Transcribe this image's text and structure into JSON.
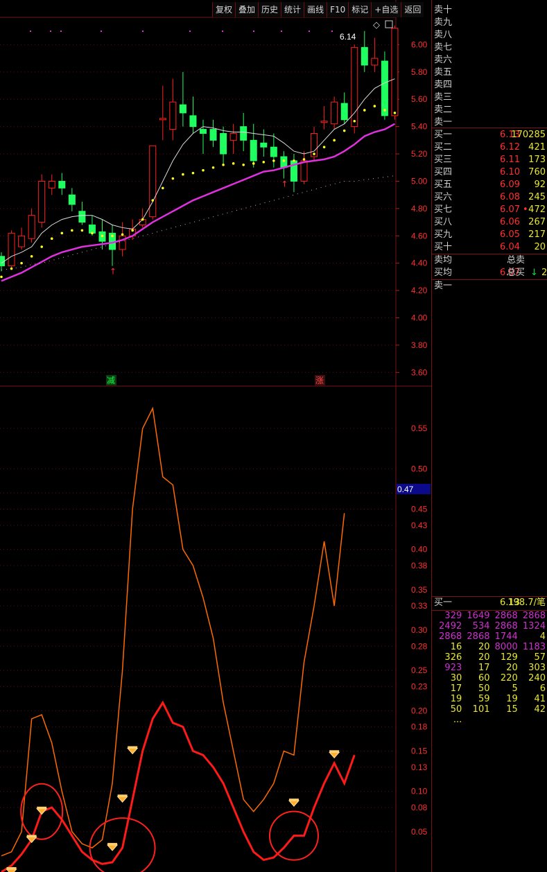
{
  "toolbar": [
    "复权",
    "叠加",
    "历史",
    "统计",
    "画线",
    "F10",
    "标记",
    "+自选",
    "返回"
  ],
  "price_axis": {
    "labels": [
      "6.00",
      "5.80",
      "5.60",
      "5.40",
      "5.20",
      "5.00",
      "4.80",
      "4.60",
      "4.40",
      "4.20",
      "4.00",
      "3.80",
      "3.60"
    ]
  },
  "high_label": "6.14",
  "markers": {
    "minus": "减",
    "plus": "涨"
  },
  "indicator_axis": {
    "labels": [
      "0.55",
      "0.50",
      "0.47",
      "0.45",
      "0.43",
      "0.40",
      "0.38",
      "0.35",
      "0.33",
      "0.30",
      "0.28",
      "0.25",
      "0.23",
      "0.20",
      "0.18",
      "0.15",
      "0.13",
      "0.10",
      "0.08",
      "0.05"
    ],
    "current": "0.47"
  },
  "order_book": {
    "sells": [
      {
        "label": "卖十"
      },
      {
        "label": "卖九"
      },
      {
        "label": "卖八"
      },
      {
        "label": "卖七"
      },
      {
        "label": "卖六"
      },
      {
        "label": "卖五"
      },
      {
        "label": "卖四"
      },
      {
        "label": "卖三"
      },
      {
        "label": "卖二"
      },
      {
        "label": "卖一"
      }
    ],
    "buys": [
      {
        "label": "买一",
        "price": "6.13",
        "vol": "170285"
      },
      {
        "label": "买二",
        "price": "6.12",
        "vol": "421"
      },
      {
        "label": "买三",
        "price": "6.11",
        "vol": "173"
      },
      {
        "label": "买四",
        "price": "6.10",
        "vol": "760"
      },
      {
        "label": "买五",
        "price": "6.09",
        "vol": "92"
      },
      {
        "label": "买六",
        "price": "6.08",
        "vol": "245"
      },
      {
        "label": "买七",
        "price": "6.07",
        "vol": "472",
        "dot": "•"
      },
      {
        "label": "买八",
        "price": "6.06",
        "vol": "267"
      },
      {
        "label": "买九",
        "price": "6.05",
        "vol": "217"
      },
      {
        "label": "买十",
        "price": "6.04",
        "vol": "20"
      }
    ],
    "avg_sell_label": "卖均",
    "total_sell_label": "总卖",
    "avg_buy_label": "买均",
    "avg_buy_price": "6.07",
    "total_buy_label": "总买",
    "total_buy_arrow": "↓",
    "total_buy_value": "2",
    "sell1_label": "卖一"
  },
  "ticks": {
    "header": {
      "label": "买一",
      "price": "6.13",
      "per": "198.7/笔"
    },
    "rows": [
      [
        {
          "v": "329",
          "c": "#d030d0"
        },
        {
          "v": "1649",
          "c": "#d030d0"
        },
        {
          "v": "2868",
          "c": "#d030d0"
        },
        {
          "v": "2868",
          "c": "#d030d0"
        }
      ],
      [
        {
          "v": "2492",
          "c": "#d030d0"
        },
        {
          "v": "534",
          "c": "#d030d0"
        },
        {
          "v": "2868",
          "c": "#d030d0"
        },
        {
          "v": "1324",
          "c": "#d030d0"
        }
      ],
      [
        {
          "v": "2868",
          "c": "#d030d0"
        },
        {
          "v": "2868",
          "c": "#d030d0"
        },
        {
          "v": "1744",
          "c": "#d030d0"
        },
        {
          "v": "4",
          "c": "#e8e832"
        }
      ],
      [
        {
          "v": "16",
          "c": "#e8e832"
        },
        {
          "v": "20",
          "c": "#e8e832"
        },
        {
          "v": "8000",
          "c": "#d030d0"
        },
        {
          "v": "1183",
          "c": "#d030d0"
        }
      ],
      [
        {
          "v": "326",
          "c": "#e8e832"
        },
        {
          "v": "20",
          "c": "#e8e832"
        },
        {
          "v": "129",
          "c": "#e8e832"
        },
        {
          "v": "57",
          "c": "#e8e832"
        }
      ],
      [
        {
          "v": "923",
          "c": "#d030d0"
        },
        {
          "v": "17",
          "c": "#e8e832"
        },
        {
          "v": "20",
          "c": "#e8e832"
        },
        {
          "v": "303",
          "c": "#e8e832"
        }
      ],
      [
        {
          "v": "30",
          "c": "#e8e832"
        },
        {
          "v": "60",
          "c": "#e8e832"
        },
        {
          "v": "220",
          "c": "#e8e832"
        },
        {
          "v": "240",
          "c": "#e8e832"
        }
      ],
      [
        {
          "v": "17",
          "c": "#e8e832"
        },
        {
          "v": "50",
          "c": "#e8e832"
        },
        {
          "v": "5",
          "c": "#e8e832"
        },
        {
          "v": "6",
          "c": "#e8e832"
        }
      ],
      [
        {
          "v": "19",
          "c": "#e8e832"
        },
        {
          "v": "59",
          "c": "#e8e832"
        },
        {
          "v": "19",
          "c": "#e8e832"
        },
        {
          "v": "41",
          "c": "#e8e832"
        }
      ],
      [
        {
          "v": "50",
          "c": "#e8e832"
        },
        {
          "v": "101",
          "c": "#e8e832"
        },
        {
          "v": "15",
          "c": "#e8e832"
        },
        {
          "v": "42",
          "c": "#e8e832"
        }
      ],
      [
        {
          "v": "...",
          "c": "#e8e832"
        },
        {
          "v": "",
          "c": "#e8e832"
        },
        {
          "v": "",
          "c": "#e8e832"
        },
        {
          "v": "",
          "c": "#e8e832"
        }
      ]
    ]
  },
  "chart_data": [
    {
      "type": "candlestick",
      "y_axis_range": [
        3.5,
        6.2
      ],
      "candles": [
        [
          4.45,
          4.38,
          4.48,
          4.34
        ],
        [
          4.38,
          4.62,
          4.64,
          4.36
        ],
        [
          4.52,
          4.6,
          4.66,
          4.5
        ],
        [
          4.58,
          4.75,
          4.8,
          4.55
        ],
        [
          4.7,
          5.0,
          5.05,
          4.66
        ],
        [
          4.95,
          5.0,
          5.05,
          4.9
        ],
        [
          5.0,
          4.95,
          5.06,
          4.9
        ],
        [
          4.9,
          4.83,
          4.95,
          4.78
        ],
        [
          4.78,
          4.7,
          4.85,
          4.68
        ],
        [
          4.68,
          4.62,
          4.75,
          4.6
        ],
        [
          4.63,
          4.56,
          4.72,
          4.5
        ],
        [
          4.62,
          4.5,
          4.68,
          4.38
        ],
        [
          4.5,
          4.6,
          4.7,
          4.45
        ],
        [
          4.6,
          4.65,
          4.72,
          4.57
        ],
        [
          4.68,
          4.72,
          4.8,
          4.66
        ],
        [
          4.74,
          5.26,
          5.26,
          4.72
        ],
        [
          5.45,
          5.46,
          5.7,
          5.3
        ],
        [
          5.38,
          5.58,
          5.75,
          5.3
        ],
        [
          5.56,
          5.5,
          5.8,
          5.4
        ],
        [
          5.48,
          5.4,
          5.62,
          5.35
        ],
        [
          5.38,
          5.35,
          5.45,
          5.2
        ],
        [
          5.38,
          5.3,
          5.45,
          5.25
        ],
        [
          5.35,
          5.2,
          5.4,
          5.12
        ],
        [
          5.3,
          5.35,
          5.42,
          5.2
        ],
        [
          5.4,
          5.3,
          5.5,
          5.22
        ],
        [
          5.3,
          5.15,
          5.42,
          5.1
        ],
        [
          5.28,
          5.25,
          5.38,
          5.18
        ],
        [
          5.25,
          5.18,
          5.35,
          5.1
        ],
        [
          5.18,
          5.1,
          5.22,
          5.02
        ],
        [
          5.15,
          5.0,
          5.2,
          4.92
        ],
        [
          5.0,
          5.15,
          5.22,
          4.98
        ],
        [
          5.18,
          5.35,
          5.4,
          5.15
        ],
        [
          5.43,
          5.44,
          5.55,
          5.38
        ],
        [
          5.42,
          5.58,
          5.62,
          5.38
        ],
        [
          5.57,
          5.45,
          5.65,
          5.42
        ],
        [
          5.4,
          5.98,
          6.0,
          5.35
        ],
        [
          5.98,
          5.85,
          6.1,
          5.8
        ],
        [
          5.85,
          5.9,
          6.05,
          5.8
        ],
        [
          5.88,
          5.48,
          5.95,
          5.45
        ],
        [
          5.48,
          6.12,
          6.14,
          5.45
        ]
      ],
      "ma_white": [
        4.4,
        4.45,
        4.48,
        4.52,
        4.62,
        4.68,
        4.72,
        4.74,
        4.75,
        4.75,
        4.72,
        4.68,
        4.66,
        4.65,
        4.72,
        4.85,
        5.0,
        5.15,
        5.27,
        5.35,
        5.4,
        5.39,
        5.37,
        5.36,
        5.36,
        5.35,
        5.34,
        5.33,
        5.28,
        5.22,
        5.2,
        5.22,
        5.3,
        5.38,
        5.42,
        5.5,
        5.6,
        5.68,
        5.72,
        5.75
      ],
      "ma_magenta": [
        4.27,
        4.3,
        4.33,
        4.37,
        4.41,
        4.45,
        4.48,
        4.5,
        4.52,
        4.53,
        4.54,
        4.55,
        4.57,
        4.6,
        4.65,
        4.7,
        4.74,
        4.78,
        4.82,
        4.86,
        4.89,
        4.92,
        4.95,
        4.98,
        5.01,
        5.04,
        5.07,
        5.08,
        5.1,
        5.12,
        5.14,
        5.15,
        5.16,
        5.18,
        5.22,
        5.27,
        5.33,
        5.36,
        5.38,
        5.42
      ],
      "ma_yellow": [
        4.3,
        4.36,
        4.4,
        4.45,
        4.52,
        4.58,
        4.62,
        4.64,
        4.64,
        4.62,
        4.6,
        4.6,
        4.61,
        4.64,
        4.72,
        4.86,
        4.95,
        5.02,
        5.05,
        5.06,
        5.08,
        5.1,
        5.12,
        5.13,
        5.12,
        5.13,
        5.14,
        5.15,
        5.15,
        5.15,
        5.16,
        5.2,
        5.25,
        5.3,
        5.37,
        5.44,
        5.52,
        5.55,
        5.52,
        5.5
      ],
      "ma_dotted": [
        4.35,
        4.36,
        4.37,
        4.39,
        4.4,
        4.42,
        4.44,
        4.46,
        4.48,
        4.5,
        4.52,
        4.54,
        4.56,
        4.58,
        4.6,
        4.62,
        4.64,
        4.66,
        4.68,
        4.7,
        4.72,
        4.74,
        4.76,
        4.78,
        4.8,
        4.82,
        4.84,
        4.86,
        4.88,
        4.9,
        4.92,
        4.94,
        4.96,
        4.98,
        5.0,
        5.0,
        5.01,
        5.02,
        5.03,
        5.04
      ]
    },
    {
      "type": "line",
      "y_axis_range": [
        0.0,
        0.6
      ],
      "series": [
        {
          "color": "#ff6a00",
          "values": [
            0.02,
            0.025,
            0.05,
            0.19,
            0.195,
            0.16,
            0.1,
            0.05,
            0.035,
            0.03,
            0.04,
            0.11,
            0.25,
            0.45,
            0.55,
            0.575,
            0.49,
            0.48,
            0.4,
            0.38,
            0.34,
            0.29,
            0.21,
            0.15,
            0.09,
            0.075,
            0.09,
            0.11,
            0.15,
            0.145,
            0.26,
            0.33,
            0.41,
            0.33,
            0.445
          ]
        },
        {
          "color": "#ff1a1a",
          "values": [
            0.0,
            0.008,
            0.022,
            0.04,
            0.075,
            0.08,
            0.065,
            0.045,
            0.025,
            0.015,
            0.01,
            0.012,
            0.03,
            0.09,
            0.15,
            0.19,
            0.21,
            0.185,
            0.18,
            0.15,
            0.145,
            0.13,
            0.11,
            0.08,
            0.05,
            0.025,
            0.015,
            0.018,
            0.03,
            0.045,
            0.045,
            0.08,
            0.11,
            0.135,
            0.11,
            0.145
          ]
        }
      ],
      "diamond_points": [
        [
          1,
          0.0
        ],
        [
          3,
          0.04
        ],
        [
          4,
          0.075
        ],
        [
          11,
          0.03
        ],
        [
          12,
          0.09
        ],
        [
          13,
          0.15
        ],
        [
          29,
          0.085
        ],
        [
          33,
          0.145
        ]
      ],
      "circles": [
        4,
        12,
        29
      ]
    }
  ]
}
